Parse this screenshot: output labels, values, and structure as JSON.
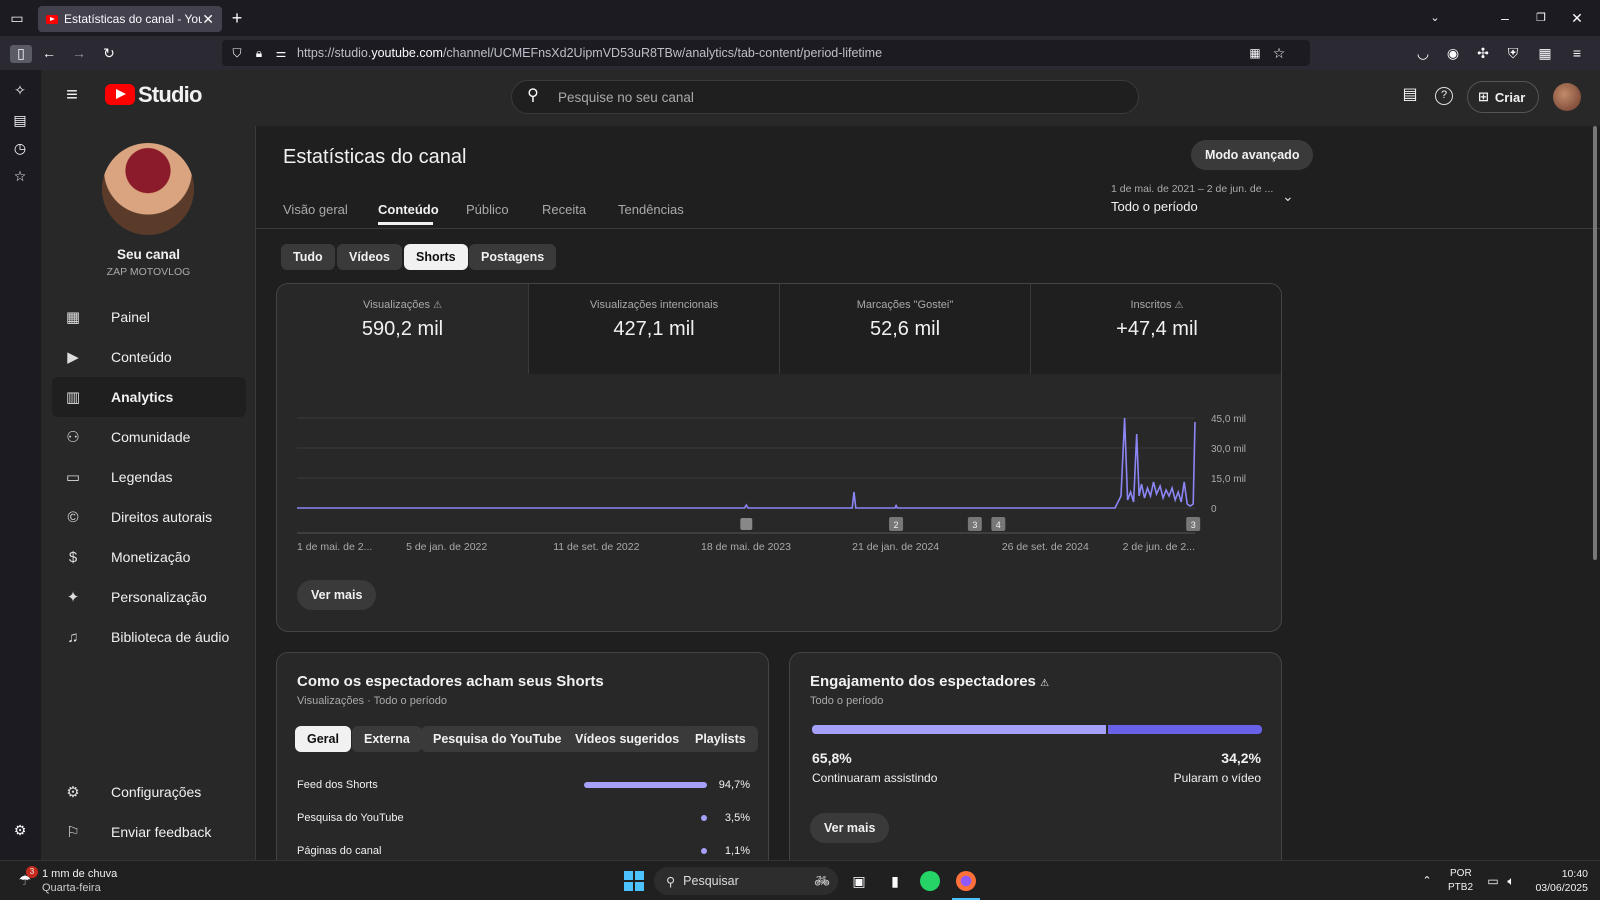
{
  "browser": {
    "tab_title": "Estatísticas do canal - YouTube",
    "url_prefix": "https://studio.",
    "url_domain": "youtube.com",
    "url_path": "/channel/UCMEFnsXd2UipmVD53uR8TBw/analytics/tab-content/period-lifetime"
  },
  "header": {
    "logo_text": "Studio",
    "search_placeholder": "Pesquise no seu canal",
    "create_label": "Criar"
  },
  "sidebar": {
    "channel_title": "Seu canal",
    "channel_name": "ZAP MOTOVLOG",
    "items": [
      {
        "label": "Painel",
        "icon": "dashboard-icon"
      },
      {
        "label": "Conteúdo",
        "icon": "content-icon"
      },
      {
        "label": "Analytics",
        "icon": "analytics-icon"
      },
      {
        "label": "Comunidade",
        "icon": "community-icon"
      },
      {
        "label": "Legendas",
        "icon": "subtitles-icon"
      },
      {
        "label": "Direitos autorais",
        "icon": "copyright-icon"
      },
      {
        "label": "Monetização",
        "icon": "dollar-icon"
      },
      {
        "label": "Personalização",
        "icon": "magic-wand-icon"
      },
      {
        "label": "Biblioteca de áudio",
        "icon": "audio-library-icon"
      }
    ],
    "settings": "Configurações",
    "feedback": "Enviar feedback"
  },
  "page": {
    "title": "Estatísticas do canal",
    "advanced_mode": "Modo avançado",
    "tabs": [
      "Visão geral",
      "Conteúdo",
      "Público",
      "Receita",
      "Tendências"
    ],
    "date_range": "1 de mai. de 2021 – 2 de jun. de ...",
    "period": "Todo o período",
    "filters": [
      "Tudo",
      "Vídeos",
      "Shorts",
      "Postagens"
    ]
  },
  "metrics": [
    {
      "label": "Visualizações",
      "value": "590,2 mil"
    },
    {
      "label": "Visualizações intencionais",
      "value": "427,1 mil"
    },
    {
      "label": "Marcações \"Gostei\"",
      "value": "52,6 mil"
    },
    {
      "label": "Inscritos",
      "value": "+47,4 mil"
    }
  ],
  "chart_data": {
    "type": "line",
    "y_ticks": [
      "45,0 mil",
      "30,0 mil",
      "15,0 mil",
      "0"
    ],
    "ylim": [
      0,
      45000
    ],
    "x_ticks": [
      "1 de mai. de 2...",
      "5 de jan. de 2022",
      "11 de set. de 2022",
      "18 de mai. de 2023",
      "21 de jan. de 2024",
      "26 de set. de 2024",
      "2 de jun. de 2..."
    ],
    "x_start": "2021-05-01",
    "x_end": "2025-06-02",
    "points": [
      [
        "2021-05-01",
        0
      ],
      [
        "2023-05-15",
        0
      ],
      [
        "2023-05-18",
        1500
      ],
      [
        "2023-05-21",
        0
      ],
      [
        "2023-11-10",
        0
      ],
      [
        "2023-11-13",
        8000
      ],
      [
        "2023-11-16",
        0
      ],
      [
        "2024-01-20",
        0
      ],
      [
        "2024-01-22",
        1200
      ],
      [
        "2024-01-24",
        0
      ],
      [
        "2025-01-20",
        0
      ],
      [
        "2025-01-25",
        3000
      ],
      [
        "2025-01-30",
        6000
      ],
      [
        "2025-02-05",
        45000
      ],
      [
        "2025-02-10",
        4000
      ],
      [
        "2025-02-15",
        8000
      ],
      [
        "2025-02-20",
        3000
      ],
      [
        "2025-02-25",
        37000
      ],
      [
        "2025-03-01",
        6000
      ],
      [
        "2025-03-05",
        12000
      ],
      [
        "2025-03-10",
        5000
      ],
      [
        "2025-03-15",
        10000
      ],
      [
        "2025-03-20",
        6000
      ],
      [
        "2025-03-25",
        13000
      ],
      [
        "2025-03-30",
        7000
      ],
      [
        "2025-04-05",
        11000
      ],
      [
        "2025-04-10",
        5000
      ],
      [
        "2025-04-15",
        9000
      ],
      [
        "2025-04-20",
        6000
      ],
      [
        "2025-04-25",
        10000
      ],
      [
        "2025-04-30",
        4000
      ],
      [
        "2025-05-05",
        8000
      ],
      [
        "2025-05-10",
        3000
      ],
      [
        "2025-05-15",
        13000
      ],
      [
        "2025-05-20",
        2000
      ],
      [
        "2025-05-25",
        1000
      ],
      [
        "2025-05-30",
        2000
      ],
      [
        "2025-06-02",
        43000
      ]
    ],
    "markers": [
      {
        "date": "2023-05-18",
        "label": ""
      },
      {
        "date": "2024-01-22",
        "label": "2"
      },
      {
        "date": "2024-06-01",
        "label": "3"
      },
      {
        "date": "2024-07-10",
        "label": "4"
      },
      {
        "date": "2025-05-30",
        "label": "3"
      }
    ],
    "line_color": "#8c86f5"
  },
  "see_more": "Ver mais",
  "traffic": {
    "title": "Como os espectadores acham seus Shorts",
    "subtitle": "Visualizações · Todo o período",
    "chips": [
      "Geral",
      "Externa",
      "Pesquisa do YouTube",
      "Vídeos sugeridos",
      "Playlists"
    ],
    "rows": [
      {
        "label": "Feed dos Shorts",
        "value": "94,7%",
        "fraction": 0.947
      },
      {
        "label": "Pesquisa do YouTube",
        "value": "3,5%",
        "fraction": 0.035
      },
      {
        "label": "Páginas do canal",
        "value": "1,1%",
        "fraction": 0.011
      }
    ]
  },
  "engagement": {
    "title": "Engajamento dos espectadores",
    "subtitle": "Todo o período",
    "stayed_value": "65,8%",
    "stayed_label": "Continuaram assistindo",
    "stayed_fraction": 0.658,
    "swiped_value": "34,2%",
    "swiped_label": "Pularam o vídeo"
  },
  "taskbar": {
    "weather_title": "1 mm de chuva",
    "weather_day": "Quarta-feira",
    "weather_badge": "3",
    "search": "Pesquisar",
    "lang1": "POR",
    "lang2": "PTB2",
    "time": "10:40",
    "date": "03/06/2025"
  }
}
